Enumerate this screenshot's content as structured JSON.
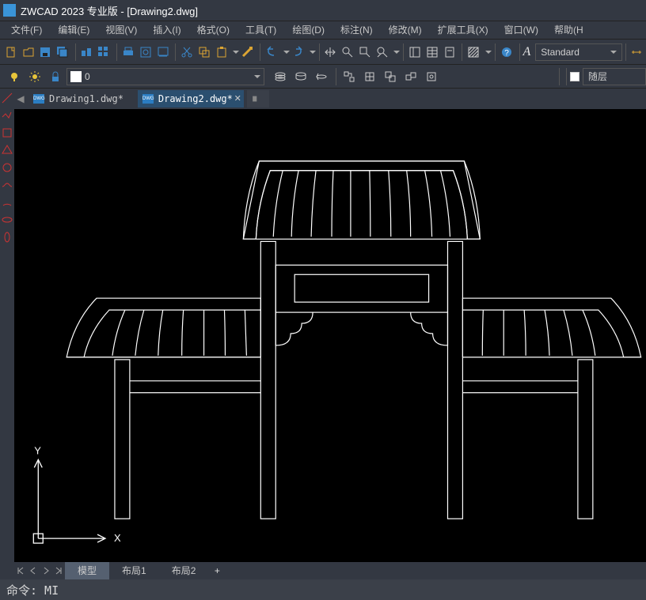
{
  "titlebar": {
    "title": "ZWCAD 2023 专业版 - [Drawing2.dwg]"
  },
  "menubar": {
    "items": [
      {
        "label": "文件(F)"
      },
      {
        "label": "编辑(E)"
      },
      {
        "label": "视图(V)"
      },
      {
        "label": "插入(I)"
      },
      {
        "label": "格式(O)"
      },
      {
        "label": "工具(T)"
      },
      {
        "label": "绘图(D)"
      },
      {
        "label": "标注(N)"
      },
      {
        "label": "修改(M)"
      },
      {
        "label": "扩展工具(X)"
      },
      {
        "label": "窗口(W)"
      },
      {
        "label": "帮助(H"
      }
    ]
  },
  "toolbar2": {
    "layer_value": "0",
    "followlayer_label": "随层"
  },
  "style_combo": {
    "value": "Standard"
  },
  "filetabs": {
    "tab0": {
      "label": "Drawing1.dwg*"
    },
    "tab1": {
      "label": "Drawing2.dwg*"
    }
  },
  "layout_tabs": {
    "model": "模型",
    "layout1": "布局1",
    "layout2": "布局2"
  },
  "commandline": {
    "text": "命令: MI"
  },
  "axes": {
    "x": "X",
    "y": "Y"
  }
}
